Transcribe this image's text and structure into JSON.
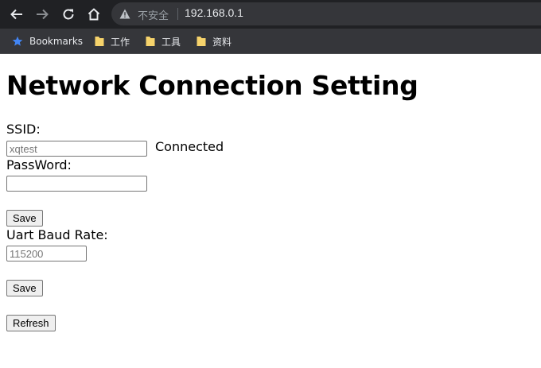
{
  "browser": {
    "security_label": "不安全",
    "url": "192.168.0.1",
    "icons": [
      "back-arrow-icon",
      "forward-arrow-icon",
      "reload-icon",
      "home-icon",
      "warning-triangle-icon"
    ]
  },
  "bookmarks_bar": {
    "items": [
      {
        "label": "Bookmarks",
        "icon": "star-icon"
      },
      {
        "label": "工作",
        "icon": "folder-icon"
      },
      {
        "label": "工具",
        "icon": "folder-icon"
      },
      {
        "label": "资料",
        "icon": "folder-icon"
      }
    ]
  },
  "page": {
    "title": "Network Connection Setting",
    "ssid": {
      "label": "SSID:",
      "value": "",
      "placeholder": "xqtest",
      "status": "Connected"
    },
    "password": {
      "label": "PassWord:",
      "value": "",
      "placeholder": ""
    },
    "save_button_1": "Save",
    "baud": {
      "label": "Uart Baud Rate:",
      "value": "",
      "placeholder": "115200"
    },
    "save_button_2": "Save",
    "refresh_button": "Refresh"
  },
  "colors": {
    "toolbar_bg": "#202124",
    "omnibox_bg": "#35363a",
    "bookmark_star": "#4285f4",
    "folder": "#f6d36b"
  }
}
